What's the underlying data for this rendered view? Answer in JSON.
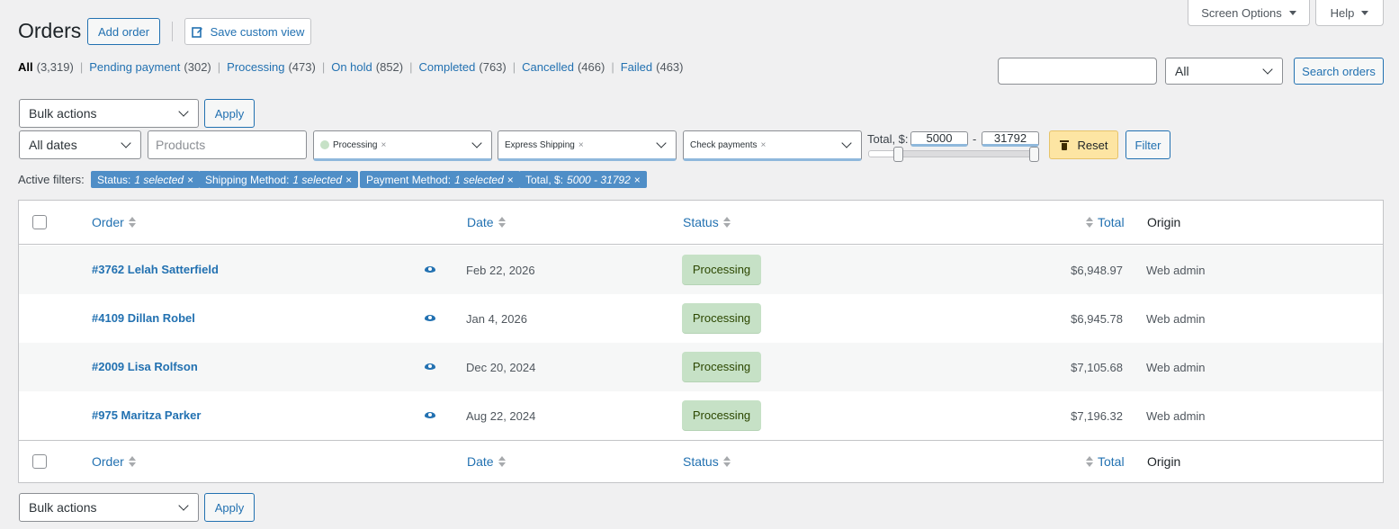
{
  "header": {
    "title": "Orders",
    "add_order": "Add order",
    "save_view": "Save custom view",
    "screen_options": "Screen Options",
    "help": "Help"
  },
  "views": [
    {
      "label": "All",
      "count": "(3,319)",
      "current": true
    },
    {
      "label": "Pending payment",
      "count": "(302)"
    },
    {
      "label": "Processing",
      "count": "(473)"
    },
    {
      "label": "On hold",
      "count": "(852)"
    },
    {
      "label": "Completed",
      "count": "(763)"
    },
    {
      "label": "Cancelled",
      "count": "(466)"
    },
    {
      "label": "Failed",
      "count": "(463)"
    }
  ],
  "search": {
    "value": "",
    "scope": "All",
    "button": "Search orders"
  },
  "bulk": {
    "label": "Bulk actions",
    "apply": "Apply"
  },
  "filters": {
    "dates": "All dates",
    "products_placeholder": "Products",
    "status_chip": "Processing",
    "shipping_chip": "Express Shipping",
    "payment_chip": "Check payments",
    "chip_remove": "×",
    "total_label": "Total, $:",
    "total_min": "5000",
    "total_max": "31792",
    "range_dash": "-",
    "reset": "Reset",
    "filter": "Filter",
    "total_range": {
      "min": 5000,
      "max": 31792,
      "selected_min": 5000,
      "selected_max": 31792
    }
  },
  "active_filters": {
    "label": "Active filters:",
    "pills": [
      {
        "name": "Status:",
        "value": "1 selected"
      },
      {
        "name": "Shipping Method:",
        "value": "1 selected"
      },
      {
        "name": "Payment Method:",
        "value": "1 selected"
      },
      {
        "name": "Total, $:",
        "value": "5000 - 31792"
      }
    ],
    "remove": "×"
  },
  "table": {
    "columns": {
      "order": "Order",
      "date": "Date",
      "status": "Status",
      "total": "Total",
      "origin": "Origin"
    },
    "rows": [
      {
        "order": "#3762 Lelah Satterfield",
        "date": "Feb 22, 2026",
        "status": "Processing",
        "total": "$6,948.97",
        "origin": "Web admin"
      },
      {
        "order": "#4109 Dillan Robel",
        "date": "Jan 4, 2026",
        "status": "Processing",
        "total": "$6,945.78",
        "origin": "Web admin"
      },
      {
        "order": "#2009 Lisa Rolfson",
        "date": "Dec 20, 2024",
        "status": "Processing",
        "total": "$7,105.68",
        "origin": "Web admin"
      },
      {
        "order": "#975 Maritza Parker",
        "date": "Aug 22, 2024",
        "status": "Processing",
        "total": "$7,196.32",
        "origin": "Web admin"
      }
    ]
  },
  "colors": {
    "accent": "#2271b1",
    "status_processing_bg": "#c6e1c6",
    "pill_bg": "#4f8ec7",
    "reset_bg": "#fde5a3"
  }
}
